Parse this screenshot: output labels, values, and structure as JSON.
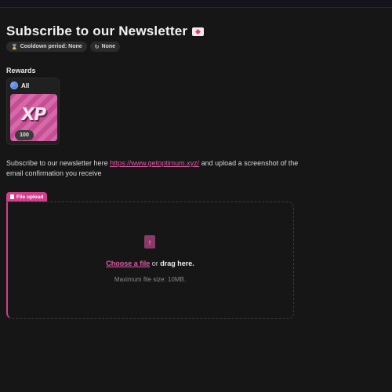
{
  "page": {
    "title": "Subscribe to our Newsletter",
    "title_icon": "mail-heart-icon"
  },
  "badges": [
    {
      "icon": "hourglass-icon",
      "label": "Cooldown period: None"
    },
    {
      "icon": "refresh-icon",
      "label": "None"
    }
  ],
  "rewards": {
    "label": "Rewards",
    "card": {
      "scope_icon": "globe-icon",
      "scope_label": "All",
      "reward_icon": "XP",
      "amount": "100"
    }
  },
  "description": {
    "before_link": "Subscribe to our newsletter here ",
    "link_text": "https://www.getoptimum.xyz/",
    "after_link": " and upload a screenshot of the email confirmation you receive"
  },
  "upload": {
    "tag_icon": "file-icon",
    "tag_label": "File upload",
    "drop_icon": "file-upload-icon",
    "choose_label": "Choose a file",
    "or_label": "or",
    "drag_label": "drag here.",
    "max_size": "Maximum file size: 10MB."
  },
  "colors": {
    "accent": "#d13f8c",
    "link": "#e05aa6",
    "background": "#161616"
  }
}
